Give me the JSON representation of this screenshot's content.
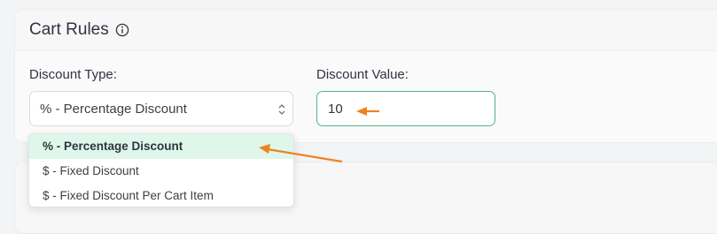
{
  "card": {
    "title": "Cart Rules",
    "info_icon": "info-circle-icon"
  },
  "discount_type": {
    "label": "Discount Type:",
    "selected": "% - Percentage Discount",
    "caret_icon": "select-caret-icon",
    "options": [
      "% - Percentage Discount",
      "$ - Fixed Discount",
      "$ - Fixed Discount Per Cart Item"
    ],
    "selected_index": 0
  },
  "discount_value": {
    "label": "Discount Value:",
    "value": "10"
  },
  "colors": {
    "accent_border": "#55b38a",
    "selected_option_bg": "#def7ea",
    "annotation_arrow": "#f0821e"
  }
}
